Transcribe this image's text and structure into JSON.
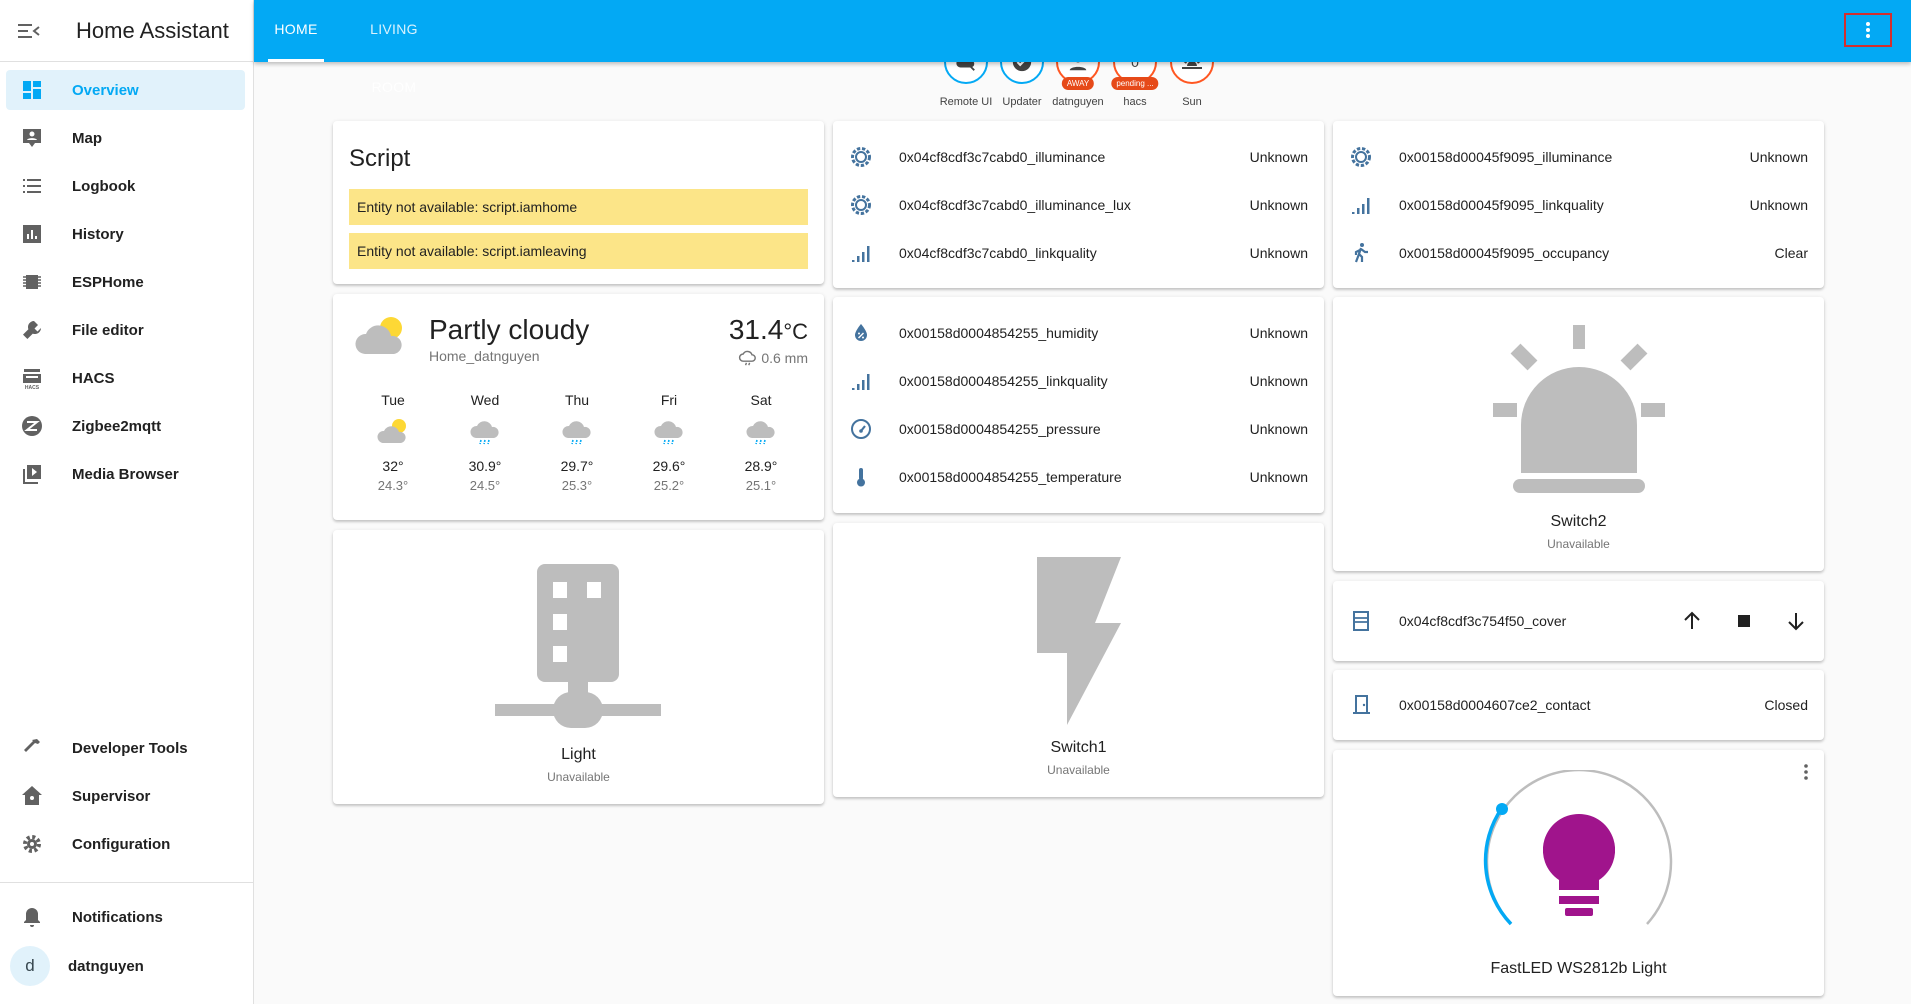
{
  "sidebar": {
    "title": "Home Assistant",
    "items": [
      {
        "label": "Overview"
      },
      {
        "label": "Map"
      },
      {
        "label": "Logbook"
      },
      {
        "label": "History"
      },
      {
        "label": "ESPHome"
      },
      {
        "label": "File editor"
      },
      {
        "label": "HACS"
      },
      {
        "label": "Zigbee2mqtt"
      },
      {
        "label": "Media Browser"
      },
      {
        "label": "Developer Tools"
      },
      {
        "label": "Supervisor"
      },
      {
        "label": "Configuration"
      }
    ],
    "notifications": "Notifications",
    "user": {
      "initial": "d",
      "name": "datnguyen"
    }
  },
  "header": {
    "tabs": [
      "HOME",
      "LIVING ROOM"
    ]
  },
  "badges": [
    {
      "label": "Remote UI"
    },
    {
      "label": "Updater"
    },
    {
      "label": "datnguyen",
      "tag": "AWAY"
    },
    {
      "label": "hacs",
      "value": "0",
      "tag": "pending ..."
    },
    {
      "label": "Sun"
    }
  ],
  "script_card": {
    "title": "Script",
    "warnings": [
      "Entity not available: script.iamhome",
      "Entity not available: script.iamleaving"
    ]
  },
  "weather": {
    "condition": "Partly cloudy",
    "name": "Home_datnguyen",
    "temp": "31.4",
    "unit": "°C",
    "precip": "0.6 mm",
    "forecast": [
      {
        "day": "Tue",
        "high": "32°",
        "low": "24.3°"
      },
      {
        "day": "Wed",
        "high": "30.9°",
        "low": "24.5°"
      },
      {
        "day": "Thu",
        "high": "29.7°",
        "low": "25.3°"
      },
      {
        "day": "Fri",
        "high": "29.6°",
        "low": "25.2°"
      },
      {
        "day": "Sat",
        "high": "28.9°",
        "low": "25.1°"
      }
    ]
  },
  "light_card": {
    "name": "Light",
    "state": "Unavailable"
  },
  "entities1": [
    {
      "name": "0x04cf8cdf3c7cabd0_illuminance",
      "state": "Unknown"
    },
    {
      "name": "0x04cf8cdf3c7cabd0_illuminance_lux",
      "state": "Unknown"
    },
    {
      "name": "0x04cf8cdf3c7cabd0_linkquality",
      "state": "Unknown"
    }
  ],
  "entities2": [
    {
      "name": "0x00158d0004854255_humidity",
      "state": "Unknown"
    },
    {
      "name": "0x00158d0004854255_linkquality",
      "state": "Unknown"
    },
    {
      "name": "0x00158d0004854255_pressure",
      "state": "Unknown"
    },
    {
      "name": "0x00158d0004854255_temperature",
      "state": "Unknown"
    }
  ],
  "switch1": {
    "name": "Switch1",
    "state": "Unavailable"
  },
  "entities3": [
    {
      "name": "0x00158d00045f9095_illuminance",
      "state": "Unknown"
    },
    {
      "name": "0x00158d00045f9095_linkquality",
      "state": "Unknown"
    },
    {
      "name": "0x00158d00045f9095_occupancy",
      "state": "Clear"
    }
  ],
  "switch2": {
    "name": "Switch2",
    "state": "Unavailable"
  },
  "cover": {
    "name": "0x04cf8cdf3c754f50_cover"
  },
  "contact": {
    "name": "0x00158d0004607ce2_contact",
    "state": "Closed"
  },
  "fastled": {
    "name": "FastLED WS2812b Light"
  },
  "colors": {
    "primary": "#03a9f4",
    "icon": "#44739e",
    "warning_bg": "#fce588",
    "bulb": "#a0148c",
    "away": "#e64a19"
  }
}
